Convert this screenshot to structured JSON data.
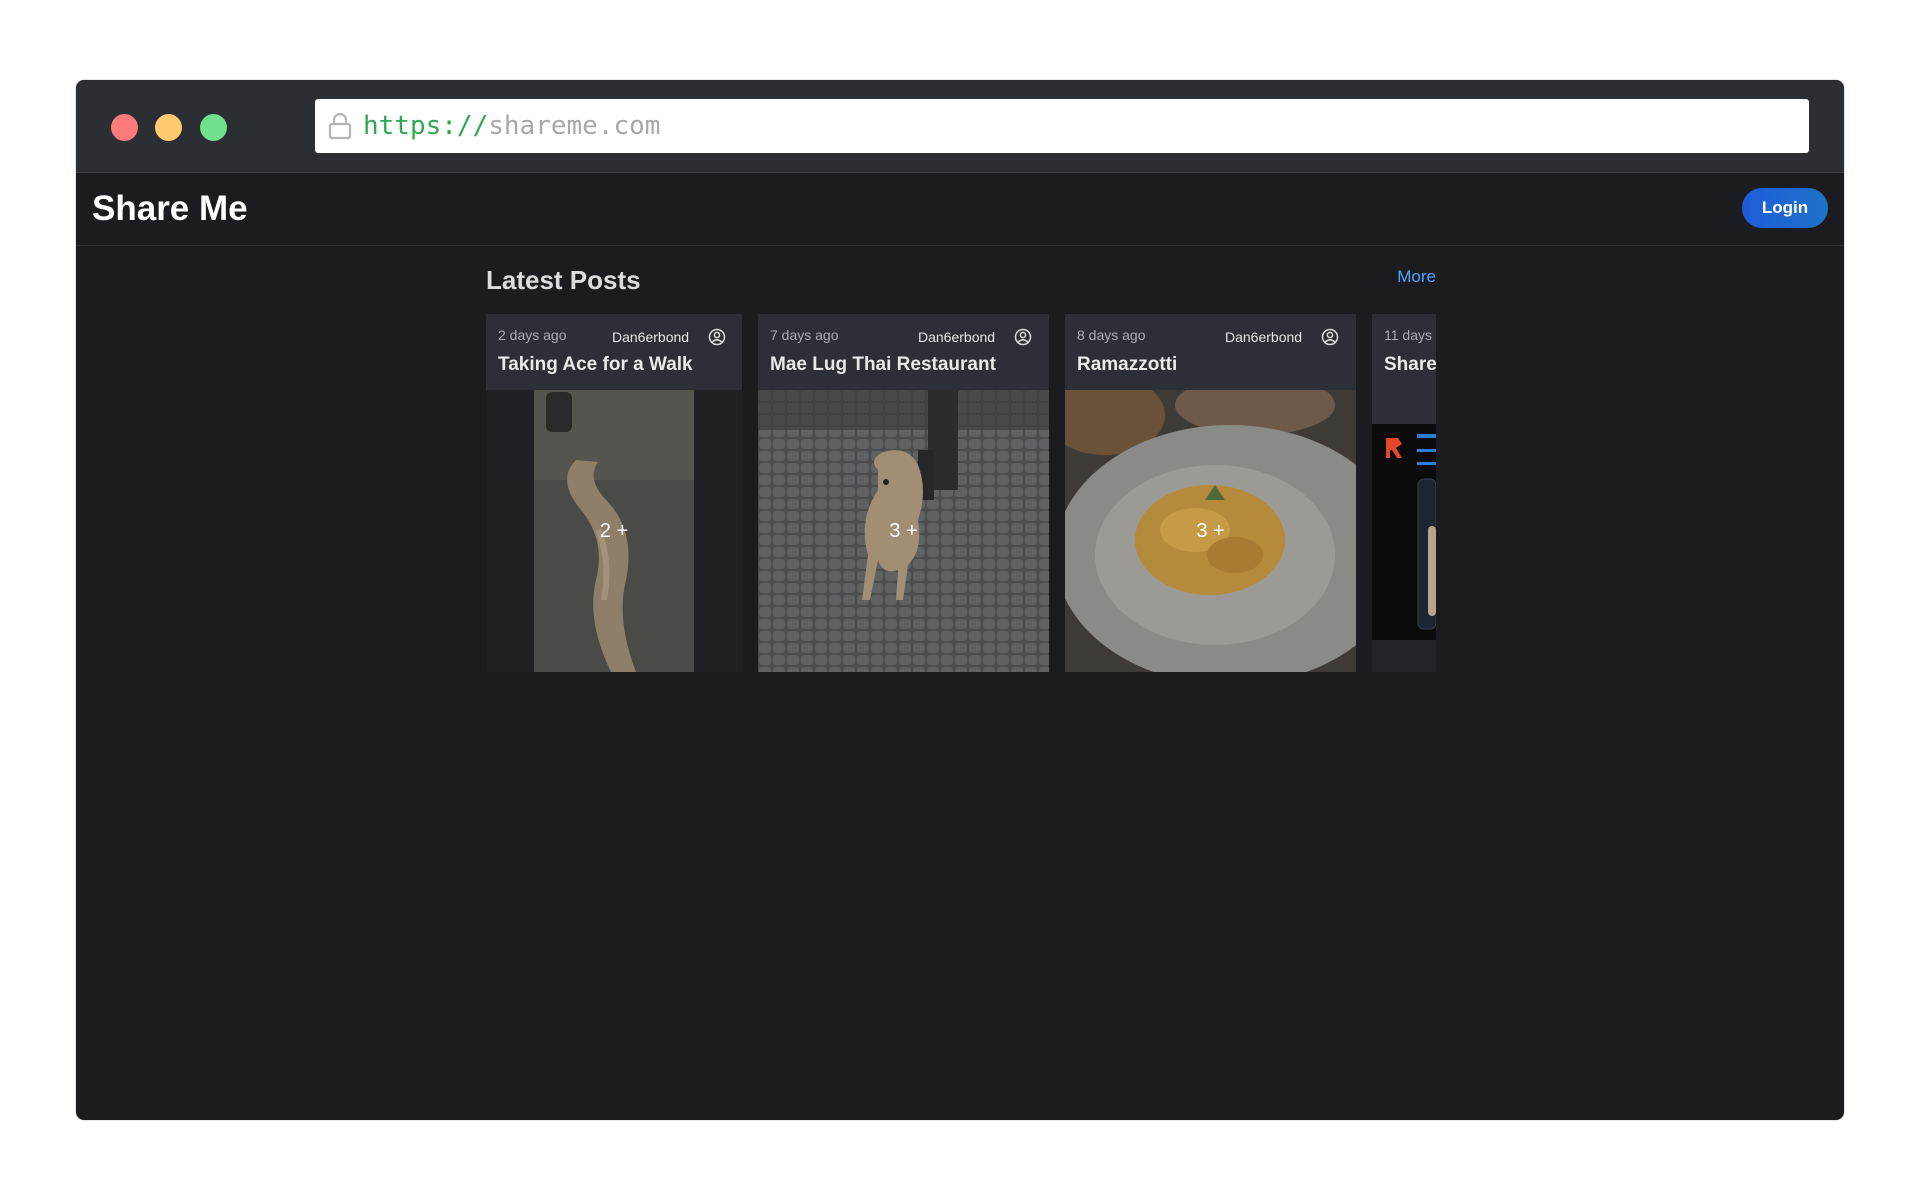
{
  "browser": {
    "url_scheme": "https://",
    "url_host": "shareme.com"
  },
  "app": {
    "title": "Share Me",
    "login_label": "Login"
  },
  "section": {
    "title": "Latest Posts",
    "more_label": "More"
  },
  "posts": [
    {
      "time": "2 days ago",
      "author": "Dan6erbond",
      "title": "Taking Ace for a Walk",
      "count": "2 +"
    },
    {
      "time": "7 days ago",
      "author": "Dan6erbond",
      "title": "Mae Lug Thai Restaurant",
      "count": "3 +"
    },
    {
      "time": "8 days ago",
      "author": "Dan6erbond",
      "title": "Ramazzotti",
      "count": "3 +"
    },
    {
      "time": "11 days",
      "title": "Share"
    }
  ],
  "colors": {
    "background": "#1b1c20",
    "accent": "#1e5bd8",
    "link": "#4fa3ff"
  },
  "icons": [
    "lock-icon",
    "user-circle-icon"
  ]
}
